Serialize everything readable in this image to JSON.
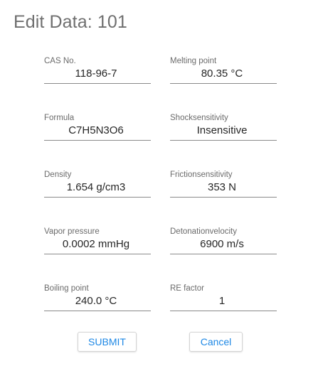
{
  "dialog": {
    "title": "Edit Data: 101"
  },
  "fields": {
    "cas_no": {
      "label": "CAS No.",
      "value": "118-96-7"
    },
    "melting_point": {
      "label": "Melting point",
      "value": "80.35 °C"
    },
    "formula": {
      "label": "Formula",
      "value": "C7H5N3O6"
    },
    "shocksensitivity": {
      "label": "Shocksensitivity",
      "value": "Insensitive"
    },
    "density": {
      "label": "Density",
      "value": "1.654 g/cm3"
    },
    "frictionsensitivity": {
      "label": "Frictionsensitivity",
      "value": "353 N"
    },
    "vapor_pressure": {
      "label": "Vapor pressure",
      "value": "0.0002 mmHg"
    },
    "detonationvelocity": {
      "label": "Detonationvelocity",
      "value": "6900 m/s"
    },
    "boiling_point": {
      "label": "Boiling point",
      "value": "240.0 °C"
    },
    "re_factor": {
      "label": "RE factor",
      "value": "1"
    }
  },
  "actions": {
    "submit_label": "SUBMIT",
    "cancel_label": "Cancel"
  },
  "colors": {
    "title": "#6f6f6f",
    "label": "#6b6b6b",
    "value": "#262626",
    "underline": "#8a8a8a",
    "button_text": "#1e88e5"
  }
}
